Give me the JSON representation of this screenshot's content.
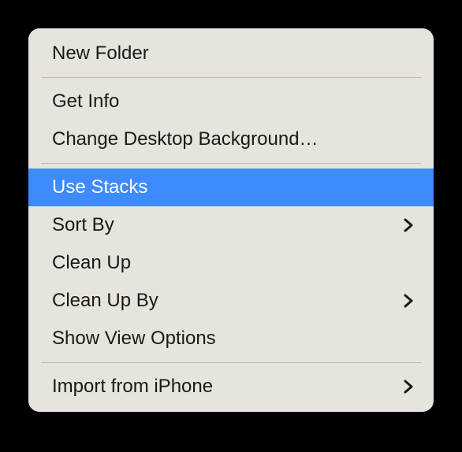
{
  "menu": {
    "highlight_bg": "#3d8bff",
    "panel_bg": "#e7e3dd",
    "groups": [
      [
        {
          "id": "new-folder",
          "label": "New Folder",
          "submenu": false,
          "highlight": false
        }
      ],
      [
        {
          "id": "get-info",
          "label": "Get Info",
          "submenu": false,
          "highlight": false
        },
        {
          "id": "change-desktop-bg",
          "label": "Change Desktop Background…",
          "submenu": false,
          "highlight": false
        }
      ],
      [
        {
          "id": "use-stacks",
          "label": "Use Stacks",
          "submenu": false,
          "highlight": true
        },
        {
          "id": "sort-by",
          "label": "Sort By",
          "submenu": true,
          "highlight": false
        },
        {
          "id": "clean-up",
          "label": "Clean Up",
          "submenu": false,
          "highlight": false
        },
        {
          "id": "clean-up-by",
          "label": "Clean Up By",
          "submenu": true,
          "highlight": false
        },
        {
          "id": "show-view-options",
          "label": "Show View Options",
          "submenu": false,
          "highlight": false
        }
      ],
      [
        {
          "id": "import-from-iphone",
          "label": "Import from iPhone",
          "submenu": true,
          "highlight": false
        }
      ]
    ]
  }
}
